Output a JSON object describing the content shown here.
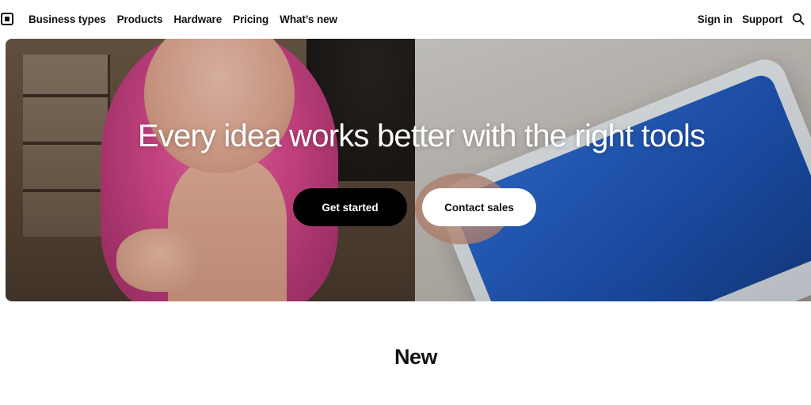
{
  "nav": {
    "left_items": [
      {
        "label": "Business types"
      },
      {
        "label": "Products"
      },
      {
        "label": "Hardware"
      },
      {
        "label": "Pricing"
      },
      {
        "label": "What’s new"
      }
    ],
    "sign_in_label": "Sign in",
    "support_label": "Support",
    "logo_icon": "square-logo-icon",
    "search_icon": "search-icon"
  },
  "hero": {
    "title": "Every idea works better with the right tools",
    "primary_button": "Get started",
    "secondary_button": "Contact sales"
  },
  "new_section": {
    "title": "New"
  },
  "colors": {
    "text": "#111111",
    "primary_button_bg": "#000000",
    "secondary_button_bg": "#ffffff",
    "hero_text": "#ffffff"
  }
}
